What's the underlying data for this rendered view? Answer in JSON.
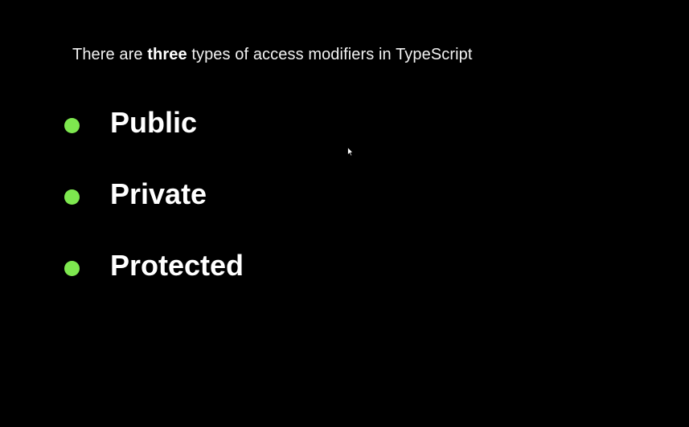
{
  "slide": {
    "intro": {
      "before": "There are ",
      "emphasis": "three",
      "after": " types of access modifiers in TypeScript"
    },
    "modifiers": [
      {
        "label": "Public"
      },
      {
        "label": "Private"
      },
      {
        "label": "Protected"
      }
    ],
    "colors": {
      "background": "#000000",
      "text": "#ffffff",
      "bullet": "#7ee84f"
    },
    "icons": {
      "bullet": "bullet-dot-icon",
      "cursor": "mouse-pointer-icon"
    }
  }
}
